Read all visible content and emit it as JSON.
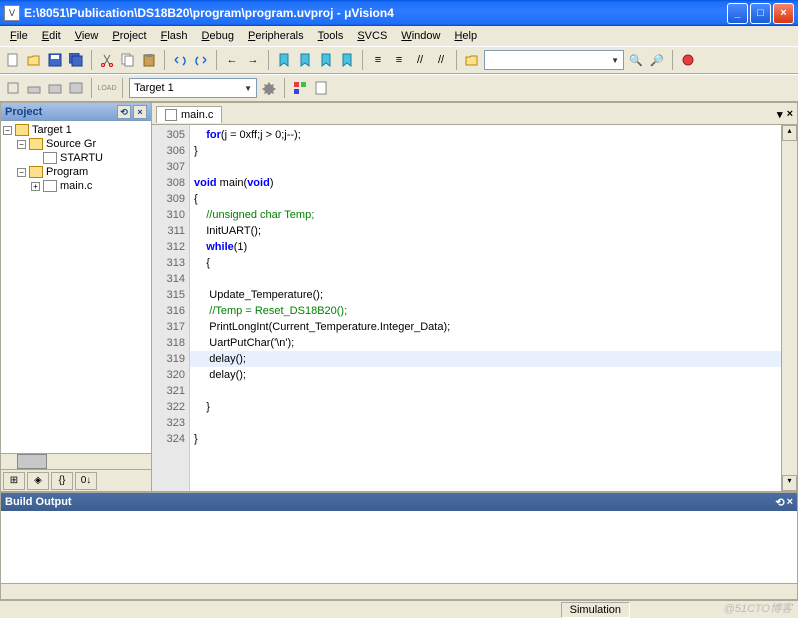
{
  "window": {
    "title": "E:\\8051\\Publication\\DS18B20\\program\\program.uvproj - μVision4",
    "icon_letter": "V"
  },
  "menu": [
    "File",
    "Edit",
    "View",
    "Project",
    "Flash",
    "Debug",
    "Peripherals",
    "Tools",
    "SVCS",
    "Window",
    "Help"
  ],
  "toolbar2": {
    "target_combo": "Target 1"
  },
  "project": {
    "title": "Project",
    "tree": {
      "target": "Target 1",
      "group1": "Source Gr",
      "file1": "STARTU",
      "group2": "Program",
      "file2": "main.c"
    },
    "tabs": [
      "⊞",
      "◈",
      "{}",
      "0↓"
    ]
  },
  "editor": {
    "tab": "main.c",
    "lines_start": 305,
    "lines_end": 324,
    "code": [
      {
        "n": 305,
        "t": "    for(j = 0xff;j > 0;j--);",
        "kw": [
          "for"
        ]
      },
      {
        "n": 306,
        "t": "}"
      },
      {
        "n": 307,
        "t": ""
      },
      {
        "n": 308,
        "t": "void main(void)",
        "kw": [
          "void",
          "void"
        ]
      },
      {
        "n": 309,
        "t": "{"
      },
      {
        "n": 310,
        "t": "    //unsigned char Temp;",
        "cm": true
      },
      {
        "n": 311,
        "t": "    InitUART();"
      },
      {
        "n": 312,
        "t": "    while(1)",
        "kw": [
          "while"
        ]
      },
      {
        "n": 313,
        "t": "    {"
      },
      {
        "n": 314,
        "t": ""
      },
      {
        "n": 315,
        "t": "     Update_Temperature();"
      },
      {
        "n": 316,
        "t": "     //Temp = Reset_DS18B20();",
        "cm": true
      },
      {
        "n": 317,
        "t": "     PrintLongInt(Current_Temperature.Integer_Data);"
      },
      {
        "n": 318,
        "t": "     UartPutChar('\\n');"
      },
      {
        "n": 319,
        "t": "     delay();",
        "hl": true
      },
      {
        "n": 320,
        "t": "     delay();"
      },
      {
        "n": 321,
        "t": ""
      },
      {
        "n": 322,
        "t": "    }"
      },
      {
        "n": 323,
        "t": ""
      },
      {
        "n": 324,
        "t": "}"
      }
    ]
  },
  "build": {
    "title": "Build Output"
  },
  "status": {
    "mode": "Simulation"
  },
  "watermark": "@51CTO博客"
}
